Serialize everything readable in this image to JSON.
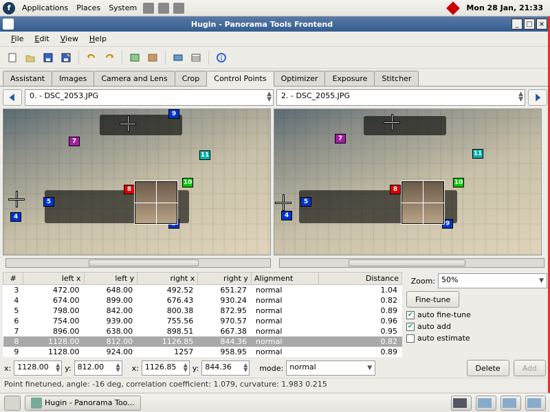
{
  "gnome": {
    "apps": "Applications",
    "places": "Places",
    "system": "System",
    "clock": "Mon 28 Jan, 21:33"
  },
  "window": {
    "title": "Hugin - Panorama Tools Frontend"
  },
  "menubar": {
    "file": "File",
    "edit": "Edit",
    "view": "View",
    "help": "Help"
  },
  "tabs": {
    "assistant": "Assistant",
    "images": "Images",
    "camera": "Camera and Lens",
    "crop": "Crop",
    "cp": "Control Points",
    "optimizer": "Optimizer",
    "exposure": "Exposure",
    "stitcher": "Stitcher"
  },
  "selectors": {
    "left": "0. - DSC_2053.JPG",
    "right": "2. - DSC_2055.JPG"
  },
  "table": {
    "headers": {
      "id": "#",
      "lx": "left x",
      "ly": "left y",
      "rx": "right x",
      "ry": "right y",
      "align": "Alignment",
      "dist": "Distance"
    },
    "rows": [
      {
        "id": "3",
        "lx": "472.00",
        "ly": "648.00",
        "rx": "492.52",
        "ry": "651.27",
        "align": "normal",
        "dist": "1.04"
      },
      {
        "id": "4",
        "lx": "674.00",
        "ly": "899.00",
        "rx": "676.43",
        "ry": "930.24",
        "align": "normal",
        "dist": "0.82"
      },
      {
        "id": "5",
        "lx": "798.00",
        "ly": "842.00",
        "rx": "800.38",
        "ry": "872.95",
        "align": "normal",
        "dist": "0.89"
      },
      {
        "id": "6",
        "lx": "754.00",
        "ly": "939.00",
        "rx": "755.56",
        "ry": "970.57",
        "align": "normal",
        "dist": "0.96"
      },
      {
        "id": "7",
        "lx": "896.00",
        "ly": "638.00",
        "rx": "898.51",
        "ry": "667.38",
        "align": "normal",
        "dist": "0.95"
      },
      {
        "id": "8",
        "lx": "1128.00",
        "ly": "812.00",
        "rx": "1126.85",
        "ry": "844.36",
        "align": "normal",
        "dist": "0.82"
      },
      {
        "id": "9",
        "lx": "1128.00",
        "ly": "924.00",
        "rx": "1257",
        "ry": "958.95",
        "align": "normal",
        "dist": "0.89"
      }
    ]
  },
  "zoom": {
    "label": "Zoom:",
    "value": "50%"
  },
  "buttons": {
    "finetune": "Fine-tune",
    "delete": "Delete",
    "add": "Add"
  },
  "checks": {
    "auto_finetune": "auto fine-tune",
    "auto_add": "auto add",
    "auto_estimate": "auto estimate"
  },
  "xy": {
    "x1": "1128.00",
    "y1": "812.00",
    "x2": "1126.85",
    "y2": "844.36",
    "mode_label": "mode:",
    "mode": "normal",
    "xlbl": "x:",
    "ylbl": "y:"
  },
  "status": "Point finetuned, angle: -16 deg, correlation coefficient: 1.079, curvature: 1.983 0.215",
  "taskbar": {
    "hugin": "Hugin - Panorama Too..."
  },
  "markers": [
    "4",
    "5",
    "7",
    "8",
    "9",
    "10",
    "11"
  ]
}
